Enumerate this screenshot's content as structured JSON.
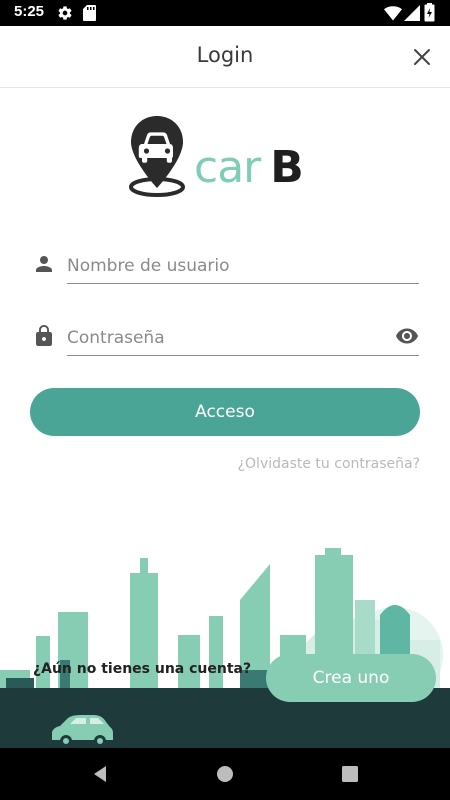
{
  "status_bar": {
    "time": "5:25",
    "icons": [
      "settings-icon",
      "sd-card-icon",
      "wifi-icon",
      "signal-icon",
      "battery-icon"
    ]
  },
  "app_bar": {
    "title": "Login",
    "close_icon": "close-icon"
  },
  "logo": {
    "text_car": "car",
    "text_b": "B",
    "colors": {
      "accent": "#7fcdb7",
      "dark": "#1f1f1f"
    }
  },
  "form": {
    "username": {
      "placeholder": "Nombre de usuario",
      "value": "",
      "icon": "person-icon"
    },
    "password": {
      "placeholder": "Contraseña",
      "value": "",
      "icon": "lock-icon",
      "toggle_icon": "eye-icon"
    },
    "login_label": "Acceso",
    "forgot_label": "¿Olvidaste tu contraseña?"
  },
  "signup": {
    "prompt": "¿Aún no tienes una cuenta?",
    "button_label": "Crea uno"
  },
  "nav_bar": {
    "icons": [
      "back-icon",
      "home-icon",
      "recents-icon"
    ]
  },
  "colors": {
    "primary": "#4aa597",
    "secondary": "#86cdb4",
    "ground": "#1f3a3b"
  }
}
